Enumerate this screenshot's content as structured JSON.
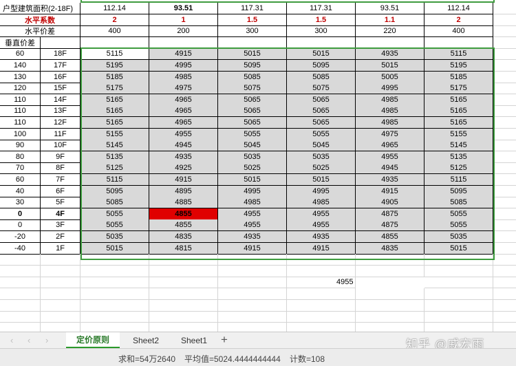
{
  "header": {
    "area_label": "户型建筑面积(2-18F)",
    "areas": [
      "112.14",
      "93.51",
      "117.31",
      "117.31",
      "93.51",
      "112.14"
    ],
    "coef_label": "水平系数",
    "coefs": [
      "2",
      "1",
      "1.5",
      "1.5",
      "1.1",
      "2"
    ],
    "hdiff_label": "水平价差",
    "hdiffs": [
      "400",
      "200",
      "300",
      "300",
      "220",
      "400"
    ],
    "vdiff_label": "垂直价差"
  },
  "rows": [
    {
      "vdiff": "60",
      "floor": "18F",
      "prices": [
        "5115",
        "4915",
        "5015",
        "5015",
        "4935",
        "5115"
      ]
    },
    {
      "vdiff": "140",
      "floor": "17F",
      "prices": [
        "5195",
        "4995",
        "5095",
        "5095",
        "5015",
        "5195"
      ]
    },
    {
      "vdiff": "130",
      "floor": "16F",
      "prices": [
        "5185",
        "4985",
        "5085",
        "5085",
        "5005",
        "5185"
      ]
    },
    {
      "vdiff": "120",
      "floor": "15F",
      "prices": [
        "5175",
        "4975",
        "5075",
        "5075",
        "4995",
        "5175"
      ]
    },
    {
      "vdiff": "110",
      "floor": "14F",
      "prices": [
        "5165",
        "4965",
        "5065",
        "5065",
        "4985",
        "5165"
      ]
    },
    {
      "vdiff": "110",
      "floor": "13F",
      "prices": [
        "5165",
        "4965",
        "5065",
        "5065",
        "4985",
        "5165"
      ]
    },
    {
      "vdiff": "110",
      "floor": "12F",
      "prices": [
        "5165",
        "4965",
        "5065",
        "5065",
        "4985",
        "5165"
      ]
    },
    {
      "vdiff": "100",
      "floor": "11F",
      "prices": [
        "5155",
        "4955",
        "5055",
        "5055",
        "4975",
        "5155"
      ]
    },
    {
      "vdiff": "90",
      "floor": "10F",
      "prices": [
        "5145",
        "4945",
        "5045",
        "5045",
        "4965",
        "5145"
      ]
    },
    {
      "vdiff": "80",
      "floor": "9F",
      "prices": [
        "5135",
        "4935",
        "5035",
        "5035",
        "4955",
        "5135"
      ]
    },
    {
      "vdiff": "70",
      "floor": "8F",
      "prices": [
        "5125",
        "4925",
        "5025",
        "5025",
        "4945",
        "5125"
      ]
    },
    {
      "vdiff": "60",
      "floor": "7F",
      "prices": [
        "5115",
        "4915",
        "5015",
        "5015",
        "4935",
        "5115"
      ]
    },
    {
      "vdiff": "40",
      "floor": "6F",
      "prices": [
        "5095",
        "4895",
        "4995",
        "4995",
        "4915",
        "5095"
      ]
    },
    {
      "vdiff": "30",
      "floor": "5F",
      "prices": [
        "5085",
        "4885",
        "4985",
        "4985",
        "4905",
        "5085"
      ]
    },
    {
      "vdiff": "0",
      "floor": "4F",
      "prices": [
        "5055",
        "4855",
        "4955",
        "4955",
        "4875",
        "5055"
      ]
    },
    {
      "vdiff": "0",
      "floor": "3F",
      "prices": [
        "5055",
        "4855",
        "4955",
        "4955",
        "4875",
        "5055"
      ]
    },
    {
      "vdiff": "-20",
      "floor": "2F",
      "prices": [
        "5035",
        "4835",
        "4935",
        "4935",
        "4855",
        "5035"
      ]
    },
    {
      "vdiff": "-40",
      "floor": "1F",
      "prices": [
        "5015",
        "4815",
        "4915",
        "4915",
        "4835",
        "5015"
      ]
    }
  ],
  "highlight": {
    "row": 14,
    "col": 1,
    "color": "#e00000"
  },
  "loose_value": "4955",
  "sheet_tabs": [
    "定价原则",
    "Sheet2",
    "Sheet1"
  ],
  "active_tab": 0,
  "status": {
    "sum": "求和=54万2640",
    "avg": "平均值=5024.4444444444",
    "count": "计数=108"
  },
  "watermark": "知乎 @戚宏雨",
  "colors": {
    "selection_border": "#3d9b3d",
    "highlight": "#e00000",
    "price_fill": "#d9d9d9",
    "coef_text": "#c00000"
  }
}
